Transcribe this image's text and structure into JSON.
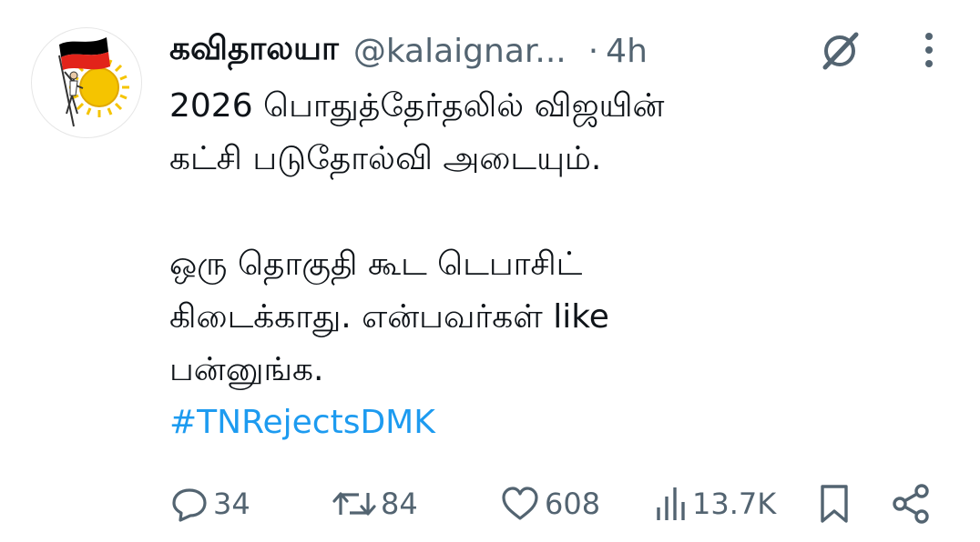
{
  "tweet": {
    "display_name": "கவிதாலயா",
    "handle": "@kalaignar...",
    "separator": "·",
    "time": "4h",
    "body_lines": [
      "2026 பொதுத்தேர்தலில் விஜயின்",
      "கட்சி படுதோல்வி அடையும்.",
      "",
      "ஒரு தொகுதி கூட டெபாசிட்",
      "கிடைக்காது. என்பவர்கள் like",
      "பன்னுங்க."
    ],
    "hashtag": "#TNRejectsDMK"
  },
  "actions": {
    "reply_count": "34",
    "retweet_count": "84",
    "like_count": "608",
    "views_count": "13.7K"
  },
  "icons": {
    "grok": "grok-icon",
    "more": "more-icon",
    "reply": "reply-icon",
    "retweet": "retweet-icon",
    "like": "heart-icon",
    "views": "views-icon",
    "bookmark": "bookmark-icon",
    "share": "share-icon"
  },
  "colors": {
    "text": "#0f1419",
    "secondary": "#536471",
    "link": "#1d9bf0",
    "avatar_flag_red": "#e2231a",
    "avatar_flag_black": "#000000",
    "avatar_sun": "#f5c400"
  }
}
